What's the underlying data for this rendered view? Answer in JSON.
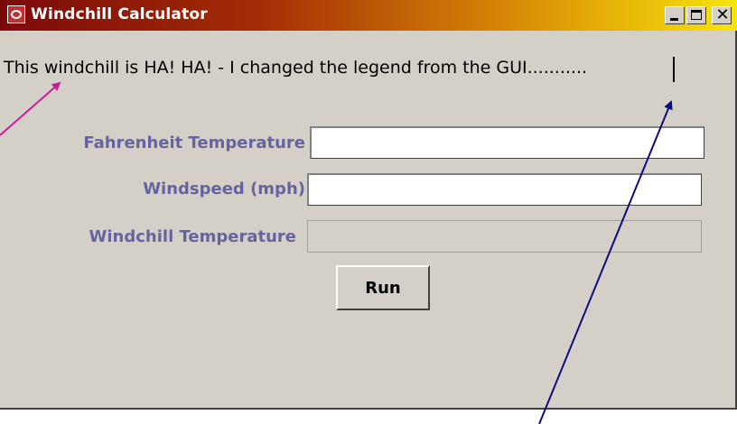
{
  "window": {
    "title": "Windchill Calculator",
    "close_glyph": "✕",
    "colors": {
      "titlebar_start": "#7b0a0a",
      "titlebar_end": "#f7e40e",
      "background": "#d4d0c8",
      "label": "#6464a0"
    }
  },
  "legend": {
    "text": "This windchill is HA! HA! - I changed the legend from the GUI..........."
  },
  "form": {
    "fahrenheit_label": "Fahrenheit Temperature",
    "fahrenheit_value": "",
    "windspeed_label": "Windspeed (mph)",
    "windspeed_value": "",
    "windchill_label": "Windchill Temperature",
    "windchill_value": ""
  },
  "run_button": {
    "label": "Run"
  },
  "annotations": {
    "arrow_left_color": "#cc1a99",
    "arrow_right_color": "#0c0c7a"
  }
}
